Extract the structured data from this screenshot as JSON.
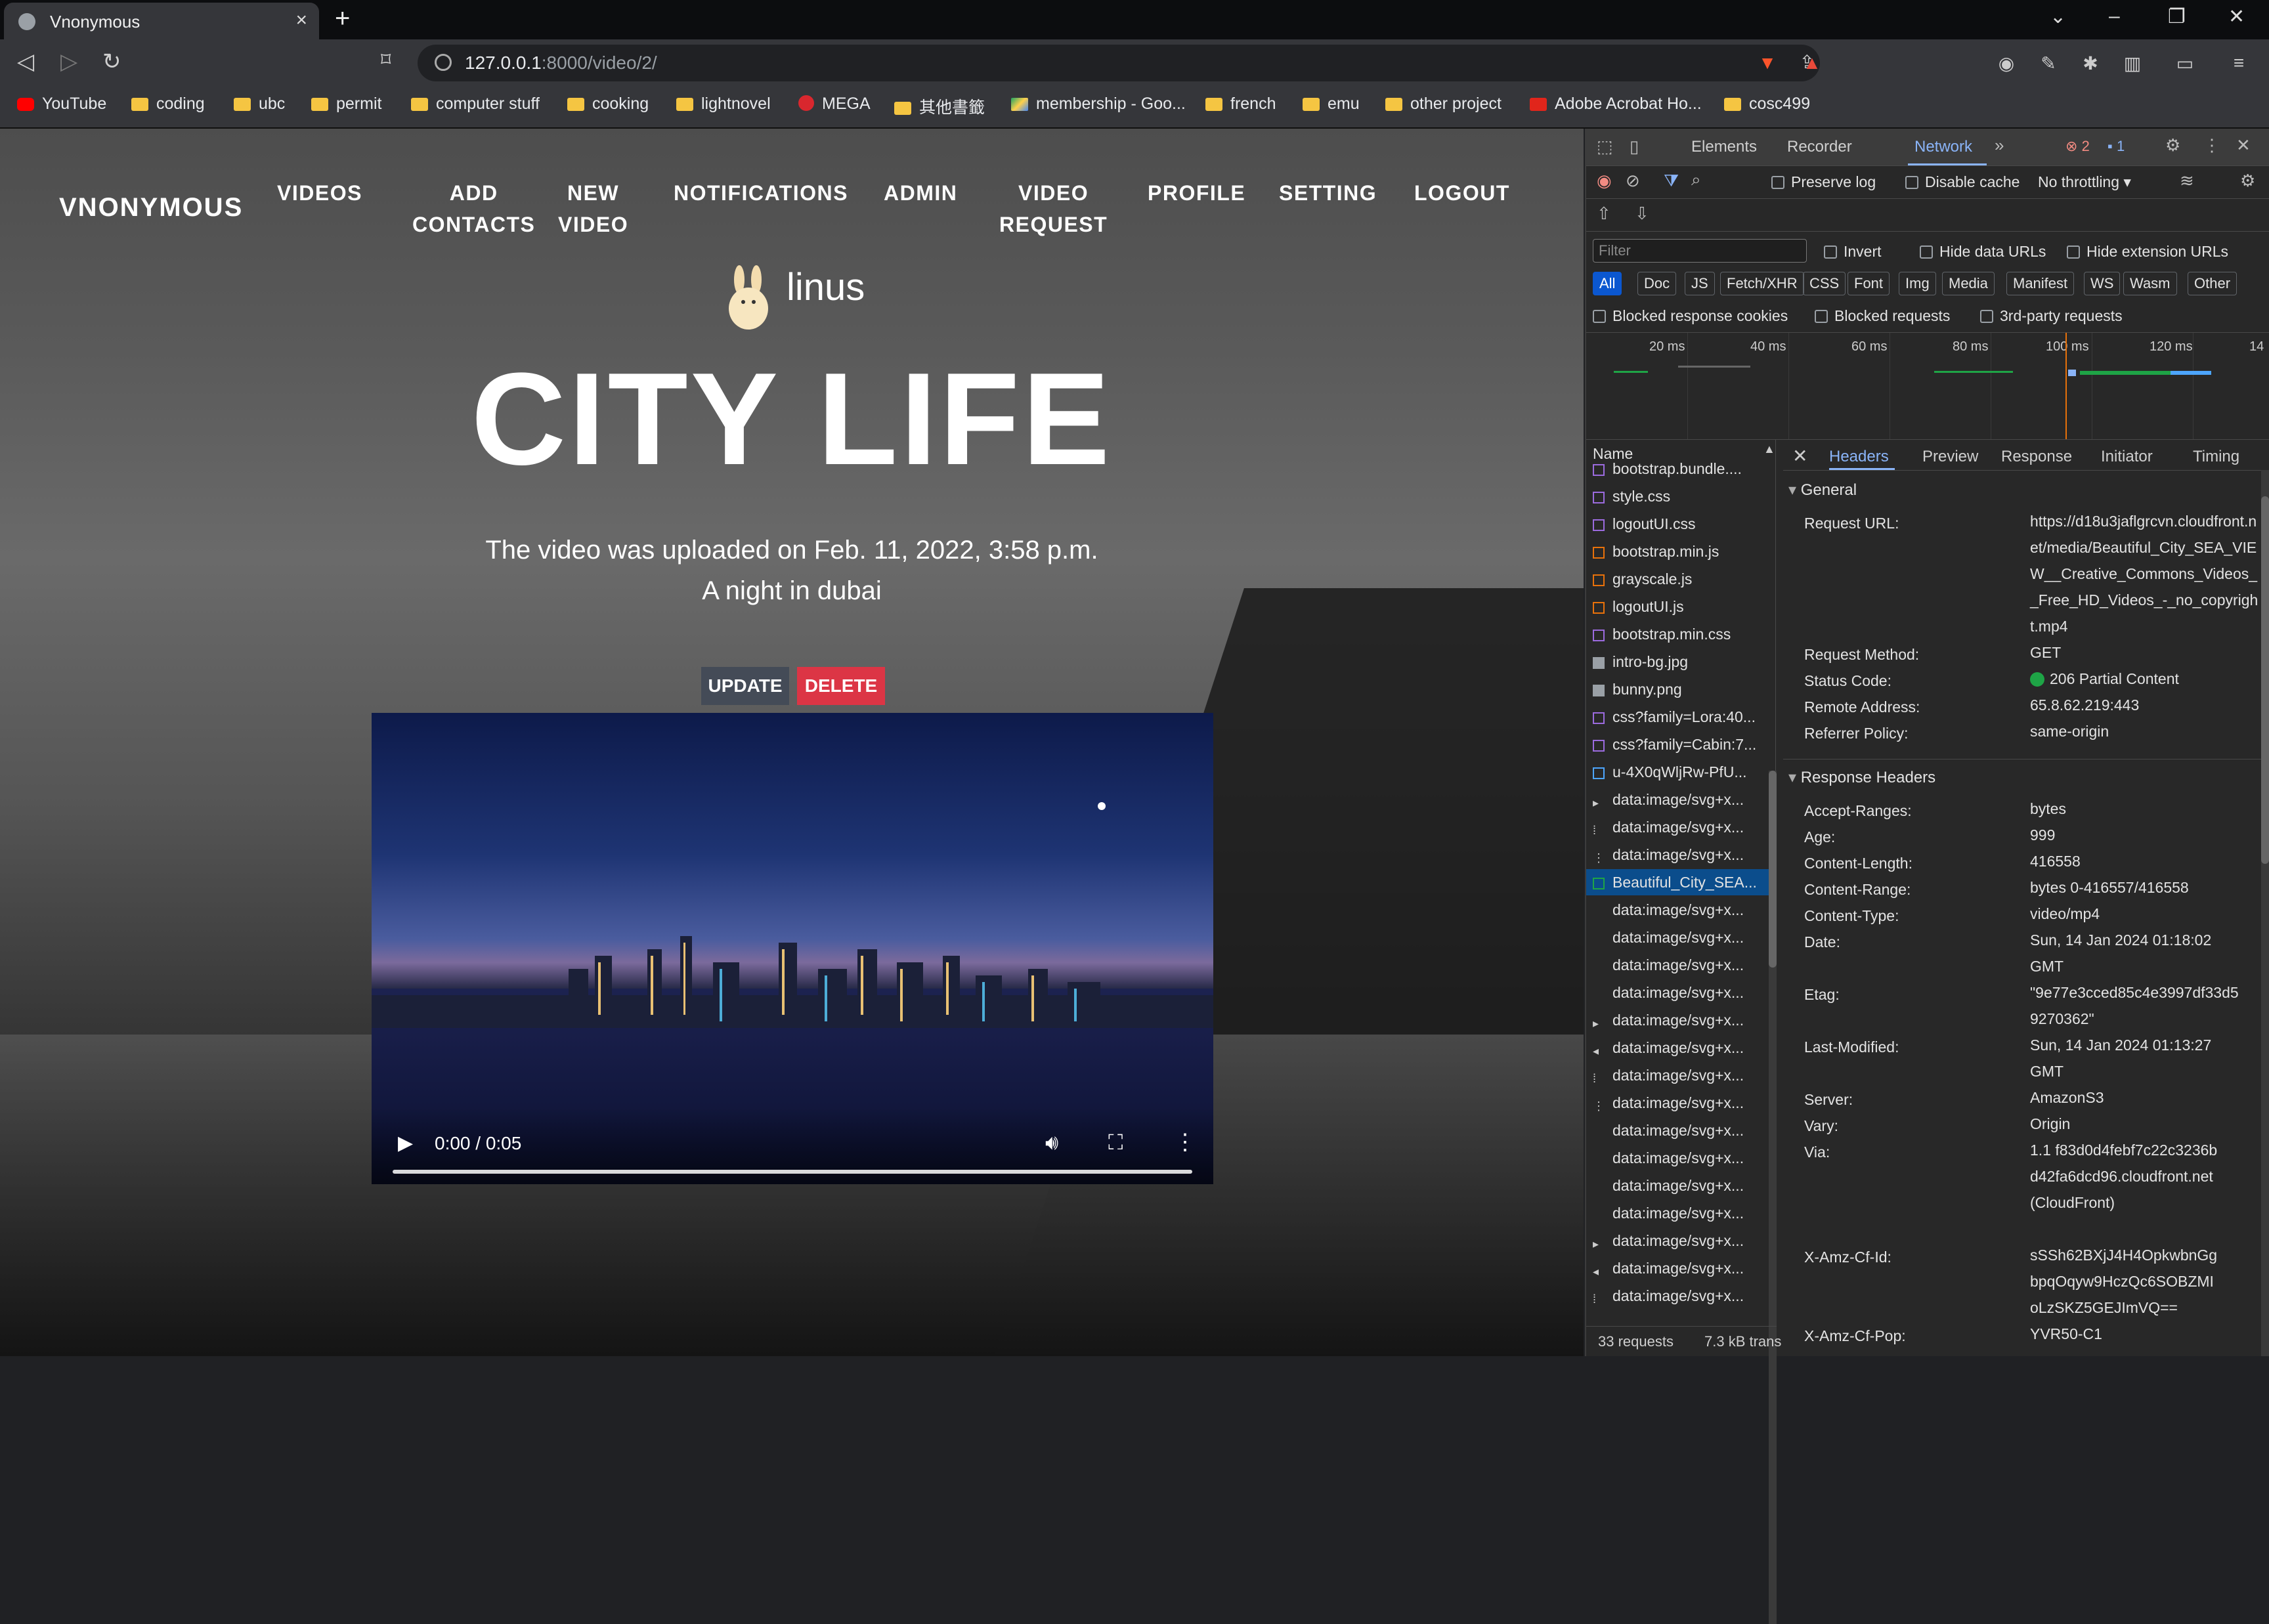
{
  "browser": {
    "tab_title": "Vnonymous",
    "url_host": "127.0.0.1",
    "url_rest": ":8000/video/2/",
    "bookmarks": [
      "YouTube",
      "coding",
      "ubc",
      "permit",
      "computer stuff",
      "cooking",
      "lightnovel",
      "MEGA",
      "其他書籤",
      "membership - Goo...",
      "french",
      "emu",
      "other project",
      "Adobe Acrobat Ho...",
      "cosc499"
    ]
  },
  "site": {
    "brand": "VNONYMOUS",
    "nav": [
      "VIDEOS",
      "ADD\nCONTACTS",
      "NEW\nVIDEO",
      "NOTIFICATIONS",
      "ADMIN",
      "VIDEO\nREQUEST",
      "PROFILE",
      "SETTING",
      "LOGOUT"
    ],
    "username": "linus",
    "video_title": "CITY LIFE",
    "uploaded_text": "The video was uploaded on Feb. 11, 2022, 3:58 p.m.",
    "description": "A night in dubai",
    "update_label": "UPDATE",
    "delete_label": "DELETE",
    "player_time": "0:00 / 0:05",
    "progress_fraction": 0
  },
  "devtools": {
    "tabs": [
      "Elements",
      "Recorder",
      "Network"
    ],
    "error_count": "2",
    "message_count": "1",
    "preserve_log": "Preserve log",
    "disable_cache": "Disable cache",
    "throttling": "No throttling",
    "filter_placeholder": "Filter",
    "invert": "Invert",
    "hide_data_urls": "Hide data URLs",
    "hide_ext_urls": "Hide extension URLs",
    "type_filters": [
      "All",
      "Doc",
      "JS",
      "Fetch/XHR",
      "CSS",
      "Font",
      "Img",
      "Media",
      "Manifest",
      "WS",
      "Wasm",
      "Other"
    ],
    "blocked_cookies": "Blocked response cookies",
    "blocked_requests": "Blocked requests",
    "third_party": "3rd-party requests",
    "timeline_ticks": [
      "20 ms",
      "40 ms",
      "60 ms",
      "80 ms",
      "100 ms",
      "120 ms",
      "14"
    ],
    "name_header": "Name",
    "requests": [
      {
        "name": "bootstrap.bundle....",
        "type": "css"
      },
      {
        "name": "style.css",
        "type": "css"
      },
      {
        "name": "logoutUI.css",
        "type": "css"
      },
      {
        "name": "bootstrap.min.js",
        "type": "js"
      },
      {
        "name": "grayscale.js",
        "type": "js"
      },
      {
        "name": "logoutUI.js",
        "type": "js"
      },
      {
        "name": "bootstrap.min.css",
        "type": "css"
      },
      {
        "name": "intro-bg.jpg",
        "type": "img"
      },
      {
        "name": "bunny.png",
        "type": "img"
      },
      {
        "name": "css?family=Lora:40...",
        "type": "css"
      },
      {
        "name": "css?family=Cabin:7...",
        "type": "css"
      },
      {
        "name": "u-4X0qWljRw-PfU...",
        "type": "font"
      },
      {
        "name": "data:image/svg+x...",
        "type": "svg",
        "glyph": "▸"
      },
      {
        "name": "data:image/svg+x...",
        "type": "svg",
        "glyph": "⁞"
      },
      {
        "name": "data:image/svg+x...",
        "type": "svg",
        "glyph": "⋮"
      },
      {
        "name": "Beautiful_City_SEA...",
        "type": "media",
        "selected": true
      },
      {
        "name": "data:image/svg+x...",
        "type": "svg",
        "glyph": ""
      },
      {
        "name": "data:image/svg+x...",
        "type": "svg",
        "glyph": ""
      },
      {
        "name": "data:image/svg+x...",
        "type": "svg",
        "glyph": ""
      },
      {
        "name": "data:image/svg+x...",
        "type": "svg",
        "glyph": ""
      },
      {
        "name": "data:image/svg+x...",
        "type": "svg",
        "glyph": "▸"
      },
      {
        "name": "data:image/svg+x...",
        "type": "svg",
        "glyph": "◂"
      },
      {
        "name": "data:image/svg+x...",
        "type": "svg",
        "glyph": "⁞"
      },
      {
        "name": "data:image/svg+x...",
        "type": "svg",
        "glyph": "⋮"
      },
      {
        "name": "data:image/svg+x...",
        "type": "svg",
        "glyph": ""
      },
      {
        "name": "data:image/svg+x...",
        "type": "svg",
        "glyph": ""
      },
      {
        "name": "data:image/svg+x...",
        "type": "svg",
        "glyph": ""
      },
      {
        "name": "data:image/svg+x...",
        "type": "svg",
        "glyph": ""
      },
      {
        "name": "data:image/svg+x...",
        "type": "svg",
        "glyph": "▸"
      },
      {
        "name": "data:image/svg+x...",
        "type": "svg",
        "glyph": "◂"
      },
      {
        "name": "data:image/svg+x...",
        "type": "svg",
        "glyph": "⁞"
      }
    ],
    "detail_tabs": [
      "Headers",
      "Preview",
      "Response",
      "Initiator",
      "Timing"
    ],
    "general_label": "General",
    "general": [
      {
        "k": "Request URL:",
        "v": "https://d18u3jaflgrcvn.cloudfront.net/media/Beautiful_City_SEA_VIEW__Creative_Commons_Videos__Free_HD_Videos_-_no_copyright.mp4"
      },
      {
        "k": "Request Method:",
        "v": "GET"
      },
      {
        "k": "Status Code:",
        "v": "206 Partial Content"
      },
      {
        "k": "Remote Address:",
        "v": "65.8.62.219:443"
      },
      {
        "k": "Referrer Policy:",
        "v": "same-origin"
      }
    ],
    "response_label": "Response Headers",
    "response": [
      {
        "k": "Accept-Ranges:",
        "v": "bytes"
      },
      {
        "k": "Age:",
        "v": "999"
      },
      {
        "k": "Content-Length:",
        "v": "416558"
      },
      {
        "k": "Content-Range:",
        "v": "bytes 0-416557/416558"
      },
      {
        "k": "Content-Type:",
        "v": "video/mp4"
      },
      {
        "k": "Date:",
        "v": "Sun, 14 Jan 2024 01:18:02 GMT"
      },
      {
        "k": "Etag:",
        "v": "\"9e77e3cced85c4e3997df33d59270362\""
      },
      {
        "k": "Last-Modified:",
        "v": "Sun, 14 Jan 2024 01:13:27 GMT"
      },
      {
        "k": "Server:",
        "v": "AmazonS3"
      },
      {
        "k": "Vary:",
        "v": "Origin"
      },
      {
        "k": "Via:",
        "v": "1.1 f83d0d4febf7c22c3236bd42fa6dcd96.cloudfront.net (CloudFront)"
      },
      {
        "k": "X-Amz-Cf-Id:",
        "v": "sSSh62BXjJ4H4OpkwbnGgbpqOqyw9HczQc6SOBZMIoLzSKZ5GEJImVQ=="
      },
      {
        "k": "X-Amz-Cf-Pop:",
        "v": "YVR50-C1"
      }
    ],
    "requests_count": "33 requests",
    "transferred": "7.3 kB trans"
  },
  "colors": {
    "accent": "#8ab4f8",
    "delete": "#dc3545",
    "selected_row": "#0b4d8c",
    "status_ok": "#1ea446"
  }
}
